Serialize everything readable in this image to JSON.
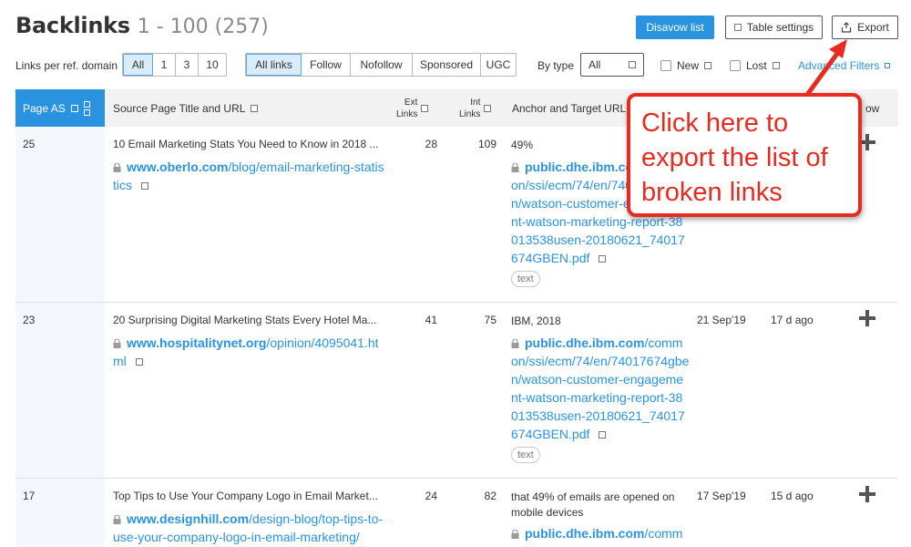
{
  "header": {
    "title": "Backlinks",
    "range": "1 - 100 (257)"
  },
  "toolbar": {
    "disavow_label": "Disavow list",
    "settings_label": "Table settings",
    "export_label": "Export"
  },
  "filters": {
    "per_domain_label": "Links per ref. domain",
    "per_domain_options": [
      "All",
      "1",
      "3",
      "10"
    ],
    "per_domain_selected": "All",
    "link_types": [
      "All links",
      "Follow",
      "Nofollow",
      "Sponsored",
      "UGC"
    ],
    "link_type_selected": "All links",
    "by_type_label": "By type",
    "by_type_value": "All",
    "new_label": "New",
    "lost_label": "Lost",
    "advanced_label": "Advanced Filters"
  },
  "table": {
    "columns": {
      "page_as": "Page AS",
      "source": "Source Page Title and URL",
      "ext_1": "Ext",
      "ext_2": "Links",
      "int_1": "Int",
      "int_2": "Links",
      "anchor": "Anchor and Target URL",
      "follow": "ow"
    },
    "rows": [
      {
        "page_as": "25",
        "title": "10 Email Marketing Stats You Need to Know in 2018 ...",
        "url_domain": "www.oberlo.com",
        "url_path": "/blog/email-marketing-statistics",
        "ext": "28",
        "int": "109",
        "anchor": "49%",
        "target_domain": "public.dhe.ibm.com",
        "target_path": "/common/ssi/ecm/74/en/74017674gben/watson-customer-engagement-watson-marketing-report-38013538usen-20180621_74017674GBEN.pdf",
        "tag": "text",
        "first_seen": "",
        "last_seen": ""
      },
      {
        "page_as": "23",
        "title": "20 Surprising Digital Marketing Stats Every Hotel Ma...",
        "url_domain": "www.hospitalitynet.org",
        "url_path": "/opinion/4095041.html",
        "ext": "41",
        "int": "75",
        "anchor": "IBM, 2018",
        "target_domain": "public.dhe.ibm.com",
        "target_path": "/common/ssi/ecm/74/en/74017674gben/watson-customer-engagement-watson-marketing-report-38013538usen-20180621_74017674GBEN.pdf",
        "tag": "text",
        "first_seen": "21 Sep'19",
        "last_seen": "17 d ago"
      },
      {
        "page_as": "17",
        "title": "Top Tips to Use Your Company Logo in Email Market...",
        "url_domain": "www.designhill.com",
        "url_path": "/design-blog/top-tips-to-use-your-company-logo-in-email-marketing/",
        "ext": "24",
        "int": "82",
        "anchor": "that 49% of emails are opened on mobile devices",
        "target_domain": "public.dhe.ibm.com",
        "target_path": "/comm",
        "tag": "",
        "first_seen": "17 Sep'19",
        "last_seen": "15 d ago"
      }
    ]
  },
  "callout": {
    "text": "Click here to export the list of broken links"
  },
  "colors": {
    "accent": "#2a93e0",
    "callout": "#e62b20"
  }
}
